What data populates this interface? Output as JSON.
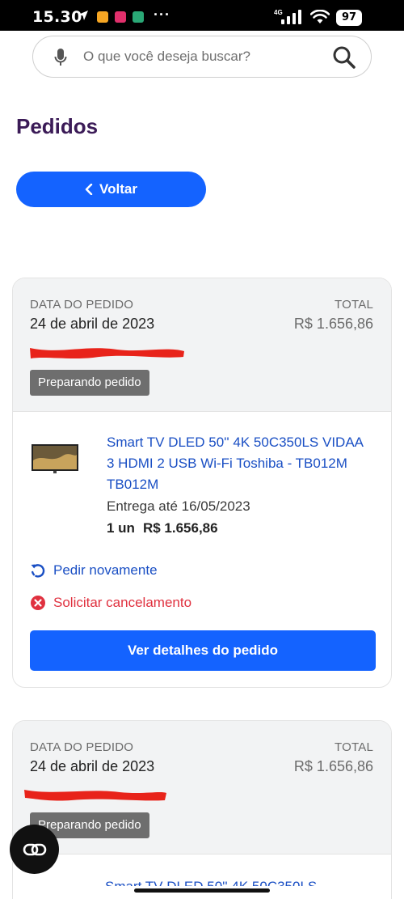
{
  "status_bar": {
    "time": "15.30",
    "network": "4G",
    "battery": "97",
    "app_icon_colors": [
      "#f6a623",
      "#e1306c",
      "#2aa876"
    ]
  },
  "search": {
    "placeholder": "O que você deseja buscar?",
    "icon_left": "microphone-icon",
    "icon_right": "search-icon"
  },
  "page": {
    "title": "Pedidos",
    "back_label": "Voltar"
  },
  "colors": {
    "primary": "#1463ff",
    "title": "#3b1b57",
    "link": "#1a4fc4",
    "danger": "#e0313f",
    "badge": "#6e6e6e"
  },
  "orders": [
    {
      "date_label": "DATA DO PEDIDO",
      "date": "24 de abril de 2023",
      "total_label": "TOTAL",
      "total": "R$ 1.656,86",
      "status": "Preparando pedido",
      "product": {
        "name": "Smart TV DLED 50'' 4K 50C350LS VIDAA 3 HDMI 2 USB Wi-Fi Toshiba - TB012M TB012M",
        "delivery": "Entrega até 16/05/2023",
        "quantity": "1 un",
        "price": "R$ 1.656,86"
      },
      "reorder_label": "Pedir novamente",
      "cancel_label": "Solicitar cancelamento",
      "details_label": "Ver detalhes do pedido"
    },
    {
      "date_label": "DATA DO PEDIDO",
      "date": "24 de abril de 2023",
      "total_label": "TOTAL",
      "total": "R$ 1.656,86",
      "status": "Preparando pedido",
      "product": {
        "name": "Smart TV DLED 50'' 4K 50C350LS"
      }
    }
  ]
}
